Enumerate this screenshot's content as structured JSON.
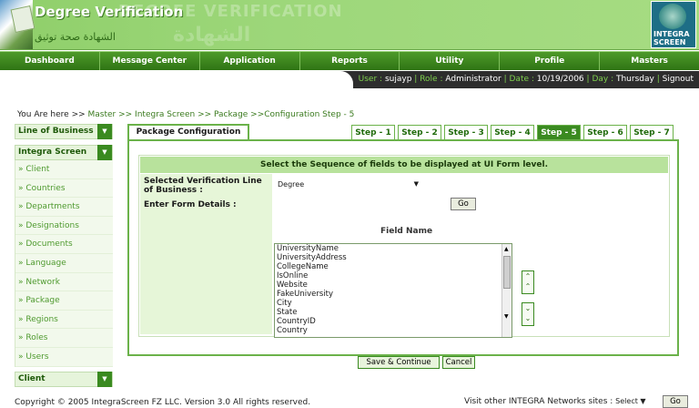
{
  "header": {
    "title": "Degree Verification",
    "arabic_subtitle": "الشهادة صحة توثيق",
    "watermark": "DEGREE VERIFICATION",
    "watermark2": "الشهادة",
    "brand_line1": "INTEGRA",
    "brand_line2": "SCREEN"
  },
  "nav": {
    "items": [
      "Dashboard",
      "Message Center",
      "Application",
      "Reports",
      "Utility",
      "Profile",
      "Masters"
    ]
  },
  "userbar": {
    "user_label": "User :",
    "user_value": "sujayp",
    "role_label": "Role :",
    "role_value": "Administrator",
    "date_label": "Date :",
    "date_value": "10/19/2006",
    "day_label": "Day :",
    "day_value": "Thursday",
    "signout": "Signout"
  },
  "breadcrumb": {
    "prefix": "You Are here >>",
    "path": " Master >> Integra Screen >> Package >>Configuration Step - 5"
  },
  "sidebar": {
    "lob_header": "Line of Business",
    "is_header": "Integra Screen",
    "items": [
      "» Client",
      "» Countries",
      "» Departments",
      "» Designations",
      "» Documents",
      "» Language",
      "» Network",
      "» Package",
      "» Regions",
      "» Roles",
      "» Users"
    ],
    "client_header": "Client"
  },
  "main": {
    "tab_label": "Package Configuration",
    "steps": [
      "Step - 1",
      "Step - 2",
      "Step - 3",
      "Step - 4",
      "Step - 5",
      "Step - 6",
      "Step - 7"
    ],
    "active_step": 4,
    "panel_heading": "Select the Sequence of fields to be displayed at UI Form level.",
    "label_lob": "Selected Verification Line of Business :",
    "label_form": "Enter Form Details :",
    "lob_selected": "Degree",
    "go_label": "Go",
    "field_name_label": "Field Name",
    "fields": [
      "UniversityName",
      "UniversityAddress",
      "CollegeName",
      "IsOnline",
      "Website",
      "FakeUniversity",
      "City",
      "State",
      "CountryID",
      "Country"
    ],
    "save_label": "Save & Continue",
    "cancel_label": "Cancel"
  },
  "footer": {
    "copyright": "Copyright © 2005 IntegraScreen FZ LLC. Version 3.0 All rights reserved.",
    "visit_label": "Visit other INTEGRA Networks sites :",
    "visit_select": "Select",
    "go_label": "Go"
  }
}
